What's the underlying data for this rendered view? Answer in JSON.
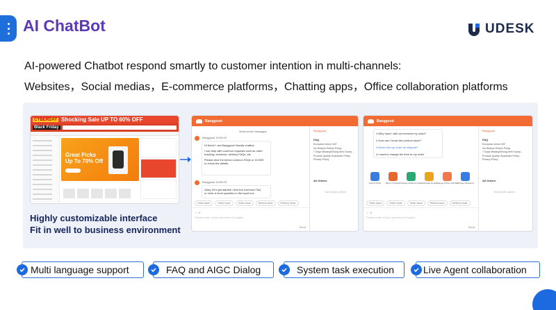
{
  "header": {
    "title": "AI ChatBot",
    "brand": "UDESK"
  },
  "intro": [
    "AI-powered Chatbot respond smartly to customer intention in multi-channels:",
    "Websites，Social medias，E-commerce platforms，Chatting apps，Office collaboration platforms"
  ],
  "ecommerce": {
    "tag": "CYBERDAY",
    "sale_text": "Shocking Sale UP TO 60% OFF",
    "black_friday": "Black Friday",
    "banner_text": "Great Picks Up To 70% Off"
  },
  "captions": [
    "Highly customizable interface",
    "Fit in well to business environment"
  ],
  "chat1": {
    "brand": "Banggood",
    "show_more": "Show more messages",
    "sender": "Banggood",
    "time1": "10:09:20",
    "msg1": [
      "Hi there! I am Banggood friendly chatbot.",
      "I can help with common requests such as order",
      "tracking, checkout, delivery FAQs, etc.",
      "Please click the below common FAQs or ICONS",
      "to check the details."
    ],
    "time2": "10:09:23",
    "msg2": [
      "Okay, let's get started! Click the common FAQ",
      "or enter a short question in the input box"
    ],
    "quick": [
      "Order Issue",
      "Order Issue",
      "Order Issue",
      "Refund Issue",
      "Delivery Issue"
    ],
    "placeholder": "Please enter a short question in English",
    "send": "Send",
    "right_title": "Banggood",
    "faq_title": "FAQ",
    "faq_items": [
      "European Union VAT",
      "No Reason Return Policy",
      "7 Days Missing/Wrong Item Guara...",
      "Product Quality Guarantee Policy",
      "Privacy Policy"
    ],
    "orders_title": "All Orders",
    "no_orders": "No recent orders"
  },
  "chat2": {
    "brand": "Banggood",
    "questions": [
      "1.Why have I still not received my order?",
      "2.How can I know the product stock?",
      "3.When will my order be shipped?",
      "4.I want to change the item in my order"
    ],
    "tasks": [
      {
        "label": "Cancel Order",
        "color": "#3a7de0"
      },
      {
        "label": "Return & Repair",
        "color": "#e8672f"
      },
      {
        "label": "Change Address Order",
        "color": "#2aa876"
      },
      {
        "label": "Download Invoice",
        "color": "#e9a51e"
      },
      {
        "label": "Change Phone Number",
        "color": "#f0784c"
      },
      {
        "label": "Change Password",
        "color": "#3a7de0"
      }
    ],
    "quick": [
      "Order Issue",
      "Order Issue",
      "Order Issue",
      "Refund Issue",
      "Delivery Issue"
    ],
    "placeholder": "Please enter a short question in English",
    "send": "Send",
    "right_title": "Banggood",
    "faq_title": "FAQ",
    "faq_items": [
      "European Union VAT",
      "No Reason Return Policy",
      "7 Days Missing/Wrong Item Guara...",
      "Product Quality Guarantee Policy",
      "Privacy Policy"
    ],
    "orders_title": "All Orders",
    "no_orders": "No recent orders"
  },
  "features": [
    "Multi language support",
    "FAQ and AIGC Dialog",
    "System task execution",
    "Live Agent collaboration"
  ],
  "colors": {
    "accent": "#1d6ae0",
    "title": "#5d39b8",
    "chat_header": "#f26b33"
  }
}
